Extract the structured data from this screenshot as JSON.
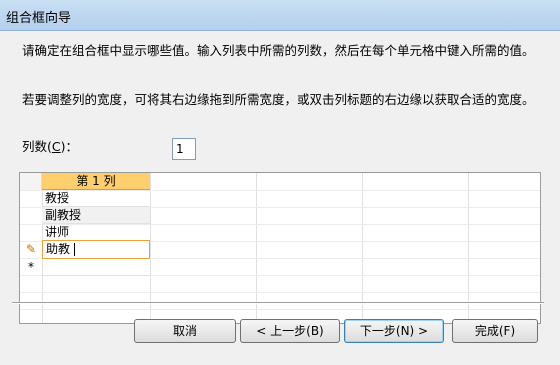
{
  "window": {
    "title": "组合框向导"
  },
  "instructions": {
    "para1": "请确定在组合框中显示哪些值。输入列表中所需的列数，然后在每个单元格中键入所需的值。",
    "para2": "若要调整列的宽度，可将其右边缘拖到所需宽度，或双击列标题的右边缘以获取合适的宽度。"
  },
  "column_count": {
    "label_prefix": "列数(",
    "label_key": "C",
    "label_suffix": ")：",
    "value": "1"
  },
  "grid": {
    "header": "第 1 列",
    "rows": [
      "教授",
      "副教授",
      "讲师",
      "助教",
      ""
    ],
    "active_row_marker": "✎",
    "new_row_marker": "*"
  },
  "buttons": {
    "cancel": "取消",
    "back": "< 上一步(B)",
    "next": "下一步(N) >",
    "finish": "完成(F)"
  }
}
